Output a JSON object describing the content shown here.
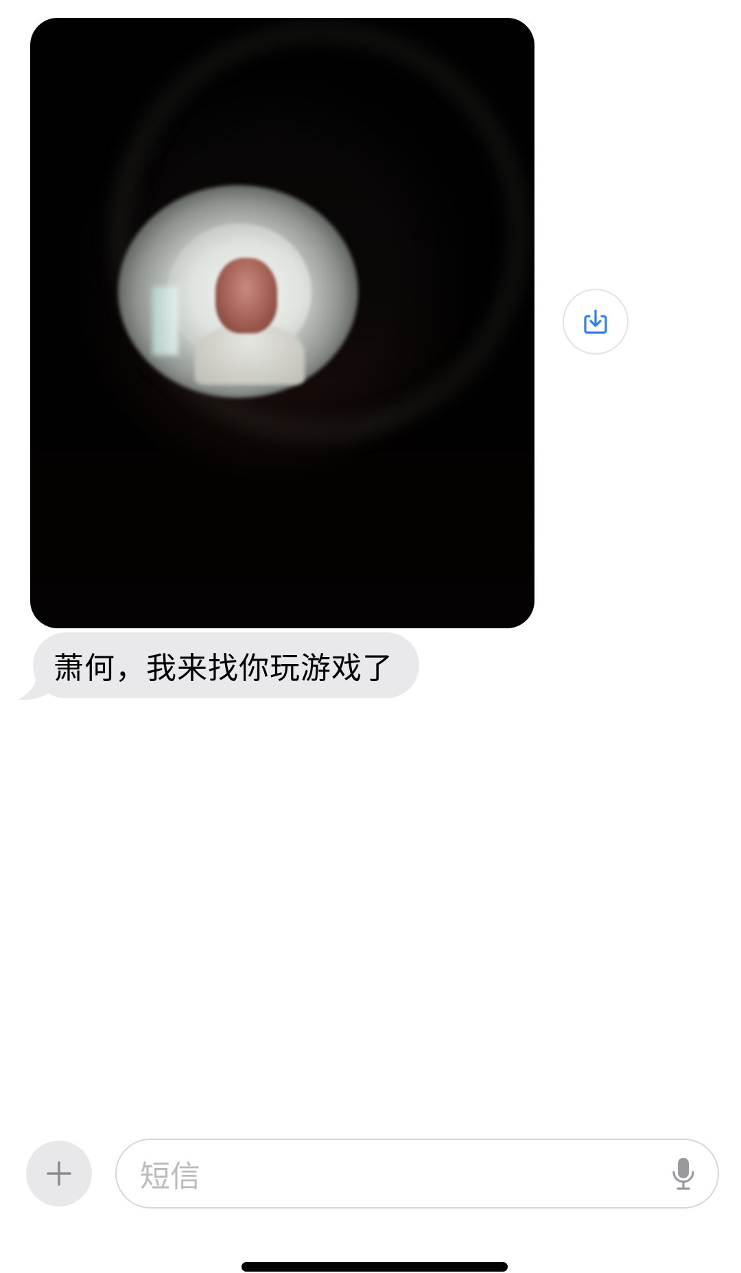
{
  "conversation": {
    "messages": [
      {
        "type": "image",
        "direction": "incoming"
      },
      {
        "type": "text",
        "direction": "incoming",
        "text": "萧何，我来找你玩游戏了"
      }
    ]
  },
  "composer": {
    "placeholder": "短信"
  },
  "icons": {
    "save": "save-download-icon",
    "add": "plus-icon",
    "mic": "microphone-icon"
  },
  "colors": {
    "accent": "#2f7cf6",
    "incoming_bubble": "#e9e9eb",
    "placeholder": "#bcbcc0"
  }
}
